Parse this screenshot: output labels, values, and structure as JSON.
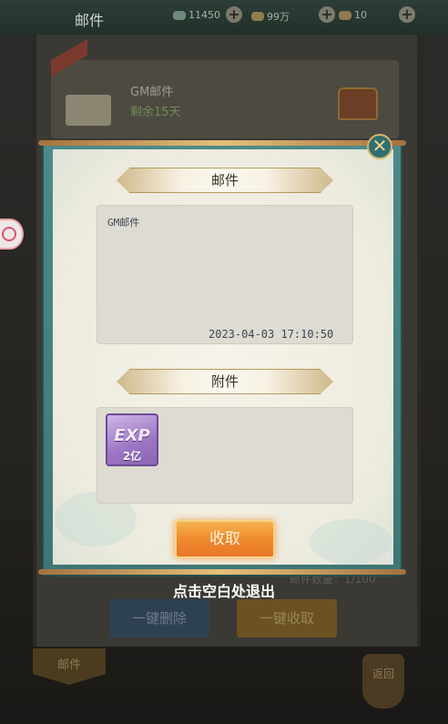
{
  "background": {
    "title": "邮件",
    "resources": [
      {
        "value": "11450",
        "icon": "jade-icon"
      },
      {
        "value": "99万",
        "icon": "gold-ingot-icon"
      },
      {
        "value": "10",
        "icon": "ticket-icon"
      }
    ],
    "mail_item": {
      "title": "GM邮件",
      "remaining": "剩余15天"
    },
    "mail_count": "邮件数量：1/100",
    "delete_all_label": "一键删除",
    "claim_all_label": "一键收取",
    "tab_label": "邮件",
    "back_label": "返回"
  },
  "popup": {
    "mail_header": "邮件",
    "sender": "GM邮件",
    "timestamp": "2023-04-03  17:10:50",
    "attachment_header": "附件",
    "attachment": {
      "label": "EXP",
      "amount": "2亿"
    },
    "claim_label": "收取",
    "close_icon": "close-x-icon"
  },
  "exit_hint": "点击空白处退出",
  "colors": {
    "frame": "#3e7676",
    "claim": "#ee8a2c",
    "exp_item": "#9c76c4"
  }
}
